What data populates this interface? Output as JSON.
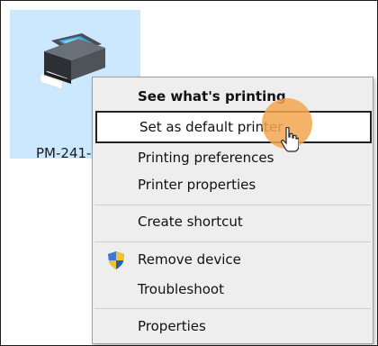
{
  "desktop": {
    "printer_label": "PM-241-"
  },
  "context_menu": {
    "items": [
      {
        "label": "See what's printing"
      },
      {
        "label": "Set as default printer"
      },
      {
        "label": "Printing preferences"
      },
      {
        "label": "Printer properties"
      },
      {
        "label": "Create shortcut"
      },
      {
        "label": "Remove device",
        "icon": "shield-icon"
      },
      {
        "label": "Troubleshoot"
      },
      {
        "label": "Properties"
      }
    ],
    "highlighted_item": "Set as default printer"
  },
  "colors": {
    "selection_tile": "#cce8ff",
    "menu_background": "#eeeeee",
    "cursor_halo": "#f3a64f"
  }
}
